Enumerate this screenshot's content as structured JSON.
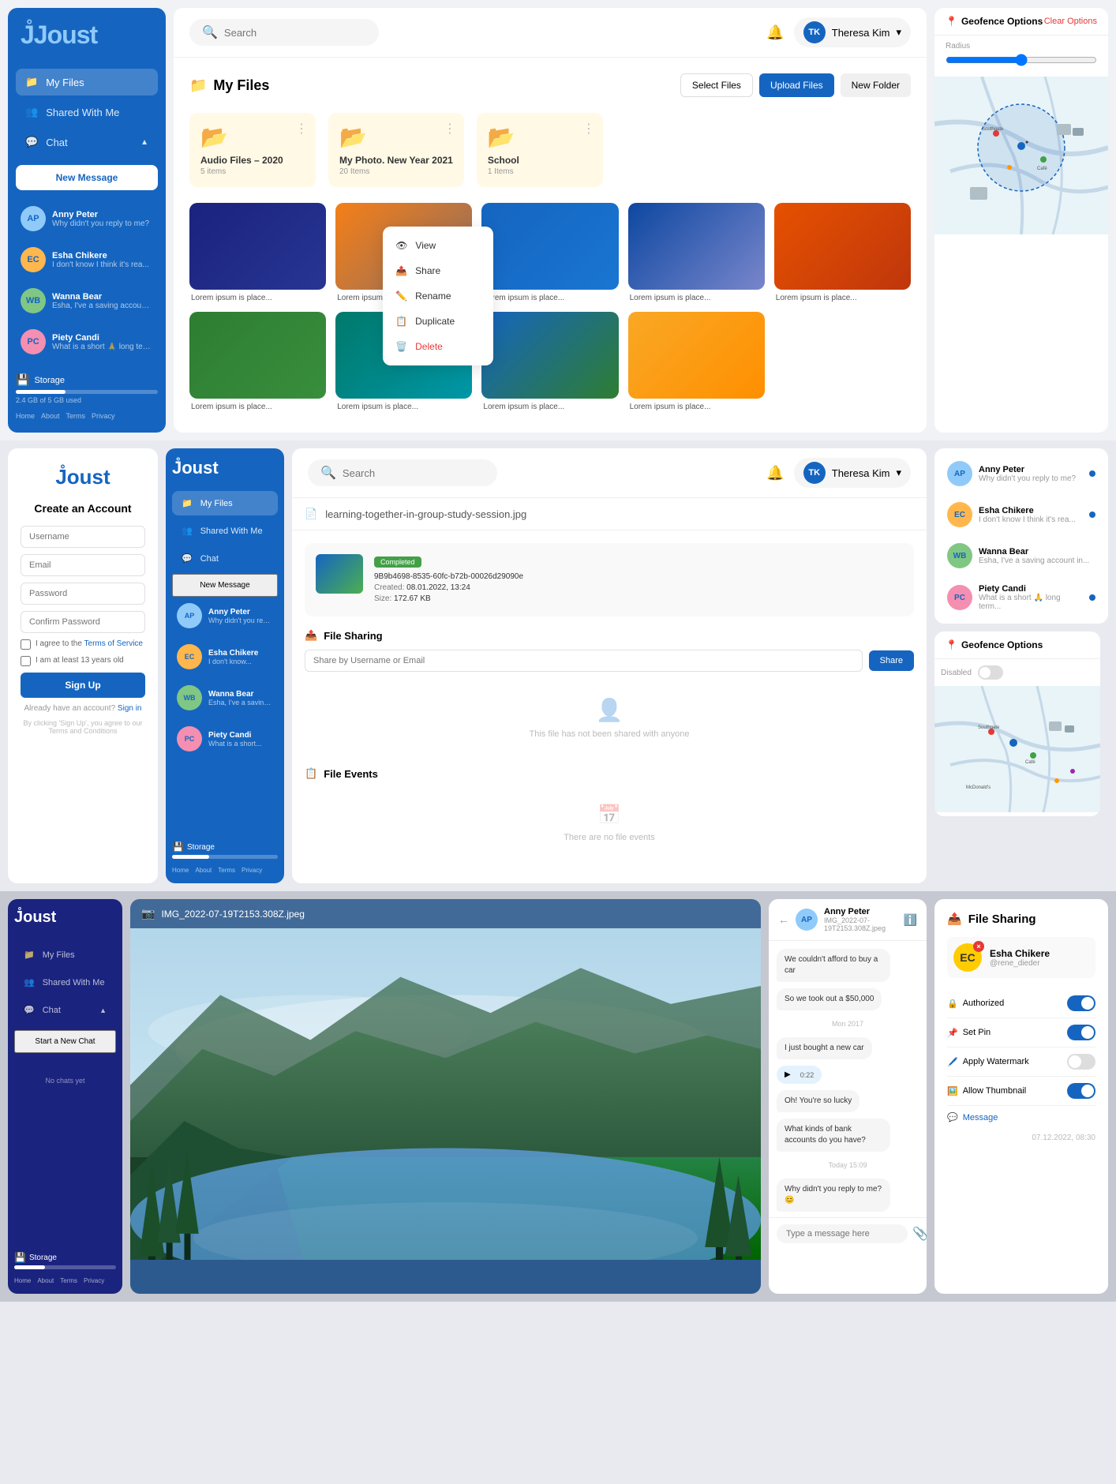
{
  "brand": {
    "name": "Joust",
    "logo_char": "J"
  },
  "section1": {
    "sidebar": {
      "nav_items": [
        {
          "label": "My Files",
          "icon": "📁",
          "active": true
        },
        {
          "label": "Shared With Me",
          "icon": "👥",
          "active": false
        },
        {
          "label": "Chat",
          "icon": "💬",
          "active": false
        }
      ],
      "new_message_btn": "New Message",
      "chat_list": [
        {
          "name": "Anny Peter",
          "preview": "Why didn't you reply to me?",
          "initials": "AP"
        },
        {
          "name": "Esha Chikere",
          "preview": "I don't know I think it's rea...",
          "initials": "EC"
        },
        {
          "name": "Wanna Bear",
          "preview": "Esha, I've a saving account in...",
          "initials": "WB"
        },
        {
          "name": "Piety Candi",
          "preview": "What is a short 🙏 long term...",
          "initials": "PC"
        }
      ],
      "storage_label": "Storage",
      "storage_info": "2.4 GB of 5 GB used",
      "footer_links": [
        "Home",
        "About",
        "Terms",
        "Privacy"
      ]
    },
    "topbar": {
      "search_placeholder": "Search",
      "user_name": "Theresa Kim",
      "user_initials": "TK"
    },
    "files": {
      "title": "My Files",
      "btn_select": "Select Files",
      "btn_upload": "Upload Files",
      "btn_folder": "New Folder",
      "folders": [
        {
          "name": "Audio Files – 2020",
          "meta": "5 items",
          "color": "#fff9e6"
        },
        {
          "name": "My Photo. New Year 2021",
          "meta": "20 Items",
          "color": "#fff9e6"
        },
        {
          "name": "School",
          "meta": "1 Items",
          "color": "#fff9e6"
        }
      ],
      "images": [
        {
          "label": "Lorem ipsum is place...",
          "type": "camera",
          "badge": ""
        },
        {
          "label": "Lorem ipsum is place...",
          "type": "squirrel",
          "badge": ""
        },
        {
          "label": "Lorem ipsum is place...",
          "type": "city",
          "badge": ""
        },
        {
          "label": "Lorem ipsum is place...",
          "type": "citynight",
          "badge": ""
        },
        {
          "label": "Lorem ipsum is place...",
          "type": "sunset",
          "badge": ""
        },
        {
          "label": "Lorem ipsum is place...",
          "type": "eagle",
          "badge": ""
        },
        {
          "label": "Lorem ipsum is place...",
          "type": "palm",
          "badge": ""
        },
        {
          "label": "Lorem ipsum is place...",
          "type": "lake",
          "badge": ""
        },
        {
          "label": "Lorem ipsum is place...",
          "type": "sun",
          "badge": ""
        }
      ],
      "context_menu": {
        "items": [
          {
            "label": "View",
            "icon": "👁"
          },
          {
            "label": "Share",
            "icon": "📤"
          },
          {
            "label": "Rename",
            "icon": "✏️"
          },
          {
            "label": "Duplicate",
            "icon": "📋"
          },
          {
            "label": "Delete",
            "icon": "🗑️",
            "danger": true
          }
        ]
      }
    },
    "map": {
      "title": "Geofence Options",
      "clear_label": "Clear Options",
      "slider_label": "Radius"
    }
  },
  "section2": {
    "signup": {
      "title": "Create an Account",
      "fields": [
        {
          "placeholder": "Username",
          "type": "text"
        },
        {
          "placeholder": "Email",
          "type": "email"
        },
        {
          "placeholder": "Password",
          "type": "password"
        },
        {
          "placeholder": "Confirm Password",
          "type": "password"
        }
      ],
      "agree_text": "I agree to the Terms of Service",
      "age_text": "I am at least 13 years old",
      "btn_signup": "Sign Up",
      "login_text": "Already have an account?",
      "login_link": "Sign in",
      "terms_text": "By clicking 'Sign Up', you agree to our Terms and Conditions"
    },
    "sidebar": {
      "nav_items": [
        {
          "label": "My Files",
          "icon": "📁",
          "active": true
        },
        {
          "label": "Shared With Me",
          "icon": "👥",
          "active": false
        },
        {
          "label": "Chat",
          "icon": "💬",
          "active": false
        }
      ],
      "new_message_btn": "New Message",
      "chat_list": [
        {
          "name": "Anny Peter",
          "preview": "Why didn't you reply to me?",
          "initials": "AP"
        },
        {
          "name": "Esha Chikere",
          "preview": "I don't know I think it's rea...",
          "initials": "EC"
        },
        {
          "name": "Wanna Bear",
          "preview": "Esha, I've a saving account in...",
          "initials": "WB"
        },
        {
          "name": "Piety Candi",
          "preview": "What is a short 🙏 long term...",
          "initials": "PC"
        }
      ],
      "storage_label": "Storage",
      "footer_links": [
        "Home",
        "About",
        "Terms",
        "Privacy"
      ]
    },
    "file_detail": {
      "filename": "learning-together-in-group-study-session.jpg",
      "status": "Completed",
      "uuid": "9B9b4698-8535-60fc-b72b-00026d29090e",
      "created": "08.01.2022, 13:24",
      "size": "172.67 KB",
      "file_sharing_title": "File Sharing",
      "share_placeholder": "Share by Username or Email",
      "share_btn": "Share",
      "no_share_text": "This file has not been shared with anyone",
      "file_events_title": "File Events",
      "no_events_text": "There are no file events"
    },
    "topbar": {
      "search_placeholder": "Search",
      "user_name": "Theresa Kim",
      "user_initials": "TK"
    },
    "chat_side": {
      "users": [
        {
          "name": "Anny Peter",
          "initials": "AP"
        },
        {
          "name": "Esha Chikere",
          "initials": "EC"
        },
        {
          "name": "Wanna Bear",
          "initials": "WB"
        },
        {
          "name": "Piety Candi",
          "initials": "PC"
        }
      ]
    }
  },
  "section3": {
    "sidebar": {
      "nav_items": [
        {
          "label": "My Files",
          "icon": "📁"
        },
        {
          "label": "Shared With Me",
          "icon": "👥"
        },
        {
          "label": "Chat",
          "icon": "💬"
        }
      ],
      "new_chat_btn": "Start a New Chat",
      "storage_label": "Storage",
      "footer_links": [
        "Home",
        "About",
        "Terms",
        "Privacy"
      ]
    },
    "preview": {
      "filename": "IMG_2022-07-19T2153.308Z.jpeg",
      "back_icon": "←"
    },
    "chat": {
      "contact_name": "Anny Peter",
      "filename": "IMG_2022-07-19T2153.308Z.jpeg",
      "messages": [
        {
          "type": "them",
          "text": "We couldn't afford to buy a car",
          "time": ""
        },
        {
          "type": "them",
          "text": "So we took out a $50,000",
          "time": ""
        },
        {
          "type": "date",
          "text": "Mon 2017"
        },
        {
          "type": "them",
          "text": "I just bought a new car",
          "time": ""
        },
        {
          "type": "them",
          "audio": true,
          "duration": "0:22",
          "time": ""
        },
        {
          "type": "them",
          "text": "Oh! You're so lucky",
          "time": ""
        },
        {
          "type": "them",
          "text": "What kinds of bank accounts do you have?",
          "time": ""
        },
        {
          "type": "date",
          "text": "Today 15:09"
        },
        {
          "type": "them",
          "text": "Why didn't you reply to me? 😊",
          "time": ""
        }
      ],
      "input_placeholder": "Type a message here"
    },
    "file_share": {
      "title": "File Sharing",
      "user": {
        "name": "Esha Chikere",
        "handle": "@rene_dieder",
        "initials": "EC"
      },
      "toggles": [
        {
          "label": "Authorized",
          "state": "on"
        },
        {
          "label": "Set Pin",
          "state": "on"
        },
        {
          "label": "Apply Watermark",
          "state": "off"
        },
        {
          "label": "Allow Thumbnail",
          "state": "on"
        }
      ],
      "message_label": "Message",
      "footer_date": "07.12.2022, 08:30"
    }
  }
}
